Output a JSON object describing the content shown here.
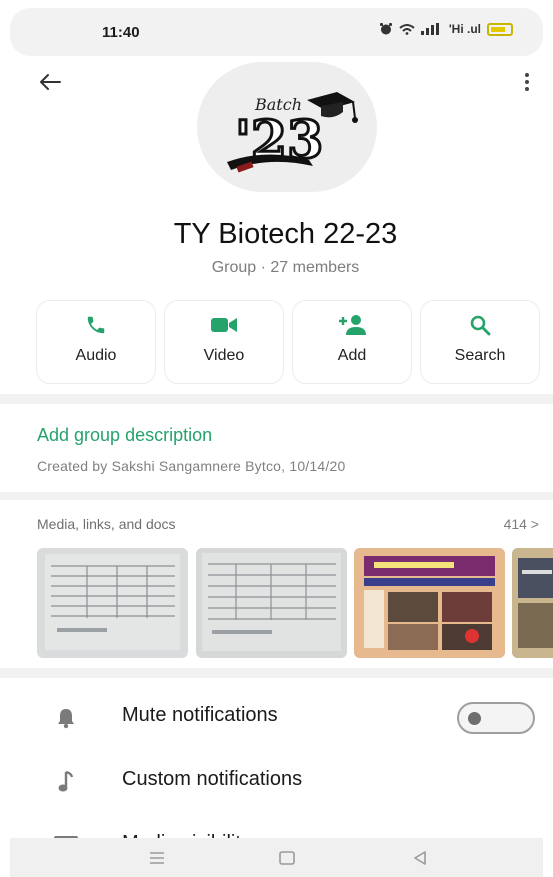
{
  "status_bar": {
    "time": "11:40",
    "signal_text": "'Hi .ul"
  },
  "header": {
    "back_icon": "arrow-left-icon",
    "menu_icon": "more-vertical-icon"
  },
  "group": {
    "avatar_text": "'23",
    "avatar_caption": "Batch",
    "name": "TY Biotech 22-23",
    "meta": "Group · 27 members"
  },
  "actions": [
    {
      "label": "Audio",
      "icon": "phone-icon"
    },
    {
      "label": "Video",
      "icon": "video-camera-icon"
    },
    {
      "label": "Add",
      "icon": "add-person-icon"
    },
    {
      "label": "Search",
      "icon": "search-icon"
    }
  ],
  "description": {
    "link": "Add group description",
    "created": "Created by Sakshi Sangamnere Bytco, 10/14/20"
  },
  "media": {
    "title": "Media, links, and docs",
    "count": "414 >"
  },
  "settings": [
    {
      "label": "Mute notifications",
      "icon": "bell-icon",
      "toggle": false
    },
    {
      "label": "Custom notifications",
      "icon": "music-note-icon"
    },
    {
      "label": "Media visibility",
      "icon": "image-icon"
    }
  ],
  "colors": {
    "accent": "#25a36b",
    "text": "#111111",
    "muted": "#7d7d7d"
  }
}
